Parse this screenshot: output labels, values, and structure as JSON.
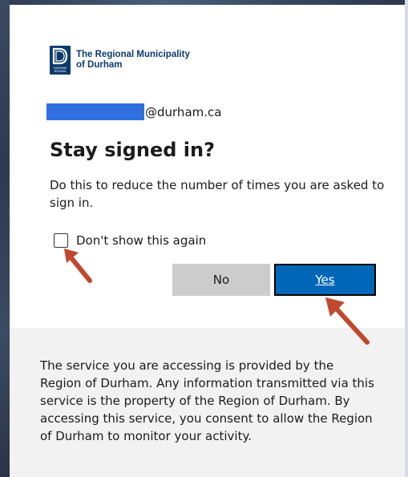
{
  "logo": {
    "line1": "The Regional Municipality",
    "line2": "of Durham",
    "mark_caption": "DURHAM REGION",
    "brand_color": "#0b3a6e"
  },
  "account": {
    "email_domain": "@durham.ca"
  },
  "dialog": {
    "title": "Stay signed in?",
    "description": "Do this to reduce the number of times you are asked to sign in.",
    "checkbox_label": "Don't show this again",
    "checkbox_checked": false,
    "no_label": "No",
    "yes_label": "Yes"
  },
  "footer": {
    "notice": "The service you are accessing is provided by the Region of Durham. Any information transmitted via this service is the property of the Region of Durham. By accessing this service, you consent to allow the Region of Durham to monitor your activity."
  },
  "colors": {
    "accent": "#0067b8",
    "redaction": "#2f6fe0",
    "annotation_arrow": "#c0482e",
    "footer_bg": "#f2f2f2"
  },
  "icons": {
    "logo_mark": "durham-region-logo-icon",
    "annotation": "arrow-annotation-icon"
  }
}
